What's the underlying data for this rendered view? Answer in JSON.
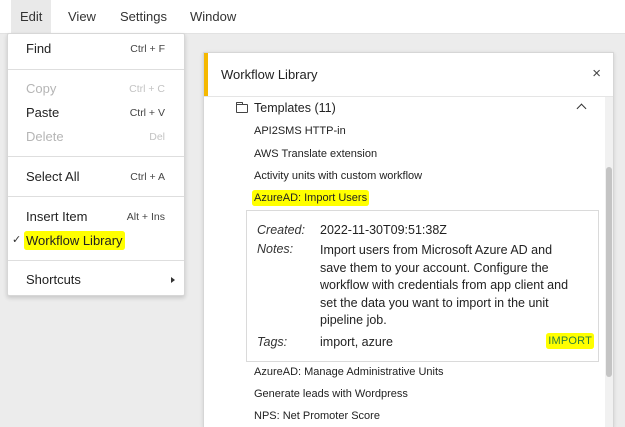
{
  "menubar": {
    "items": [
      {
        "label": "Edit",
        "active": true
      },
      {
        "label": "View",
        "active": false
      },
      {
        "label": "Settings",
        "active": false
      },
      {
        "label": "Window",
        "active": false
      }
    ]
  },
  "edit_menu": {
    "items": [
      {
        "label": "Find",
        "shortcut": "Ctrl + F",
        "disabled": false
      },
      {
        "label": "Copy",
        "shortcut": "Ctrl + C",
        "disabled": true
      },
      {
        "label": "Paste",
        "shortcut": "Ctrl + V",
        "disabled": false
      },
      {
        "label": "Delete",
        "shortcut": "Del",
        "disabled": true
      },
      {
        "label": "Select All",
        "shortcut": "Ctrl + A",
        "disabled": false
      },
      {
        "label": "Insert Item",
        "shortcut": "Alt + Ins",
        "disabled": false
      },
      {
        "label": "Workflow Library",
        "checked": true,
        "highlighted": true
      },
      {
        "label": "Shortcuts",
        "submenu": true
      }
    ],
    "checkmark": "✓"
  },
  "panel": {
    "title": "Workflow Library",
    "close_glyph": "×",
    "group": {
      "label": "Templates (11)",
      "expanded": true
    },
    "templates": [
      "API2SMS HTTP-in",
      "AWS Translate extension",
      "Activity units with custom workflow",
      "AzureAD: Import Users",
      "AzureAD: Manage Administrative Units",
      "Generate leads with Wordpress",
      "NPS: Net Promoter Score"
    ],
    "selected_index": 3,
    "details": {
      "created_label": "Created:",
      "created_value": "2022-11-30T09:51:38Z",
      "notes_label": "Notes:",
      "notes_value": "Import users from Microsoft Azure AD and save them to your account. Configure the workflow with credentials from app client and set the data you want to import in the unit pipeline job.",
      "tags_label": "Tags:",
      "tags_value": "import, azure",
      "import_label": "IMPORT"
    },
    "accent_color": "#f5b800",
    "highlight_color": "#ffff00",
    "import_color": "#2f7f3a"
  }
}
